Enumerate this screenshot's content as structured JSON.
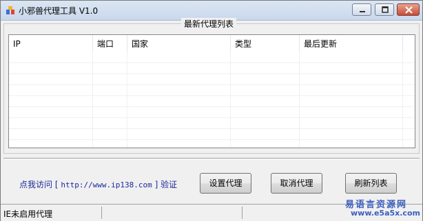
{
  "window": {
    "title": "小邪兽代理工具 V1.0"
  },
  "group": {
    "title": "最新代理列表"
  },
  "list": {
    "columns": [
      "IP",
      "端口",
      "国家",
      "类型",
      "最后更新"
    ],
    "rows": []
  },
  "footer": {
    "info_prefix": "点我访问 [",
    "info_url": "http://www.ip138.com",
    "info_suffix": "] 验证",
    "set_proxy_label": "设置代理",
    "cancel_proxy_label": "取消代理",
    "refresh_label": "刷新列表"
  },
  "statusbar": {
    "text": "IE未启用代理"
  },
  "watermark": {
    "cn": "易语言资源网",
    "url": "www.e5a5x.com"
  },
  "colors": {
    "link": "#1a2a9c",
    "close_button": "#c84c36",
    "watermark": "#3b5dbf"
  }
}
